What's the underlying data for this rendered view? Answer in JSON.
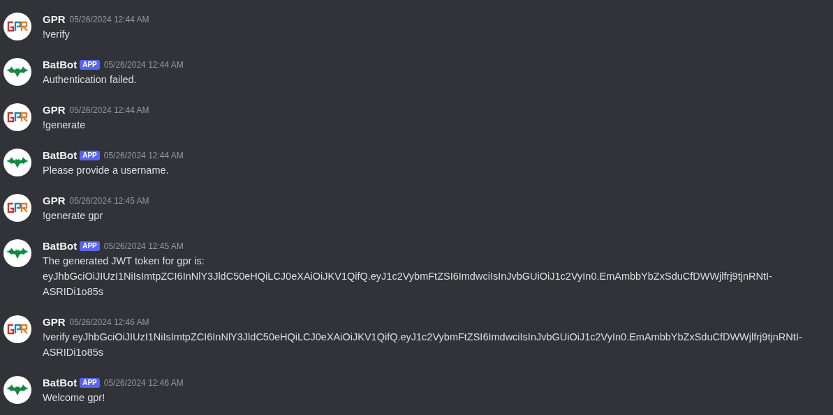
{
  "messages": [
    {
      "author": "GPR",
      "kind": "user",
      "timestamp": "05/26/2024 12:44 AM",
      "lines": [
        "!verify"
      ]
    },
    {
      "author": "BatBot",
      "kind": "bot",
      "badge": "APP",
      "timestamp": "05/26/2024 12:44 AM",
      "lines": [
        "Authentication failed."
      ]
    },
    {
      "author": "GPR",
      "kind": "user",
      "timestamp": "05/26/2024 12:44 AM",
      "lines": [
        "!generate"
      ]
    },
    {
      "author": "BatBot",
      "kind": "bot",
      "badge": "APP",
      "timestamp": "05/26/2024 12:44 AM",
      "lines": [
        "Please provide a username."
      ]
    },
    {
      "author": "GPR",
      "kind": "user",
      "timestamp": "05/26/2024 12:45 AM",
      "lines": [
        "!generate gpr"
      ]
    },
    {
      "author": "BatBot",
      "kind": "bot",
      "badge": "APP",
      "timestamp": "05/26/2024 12:45 AM",
      "lines": [
        "The generated JWT token for gpr is:",
        "eyJhbGciOiJIUzI1NiIsImtpZCI6InNlY3JldC50eHQiLCJ0eXAiOiJKV1QifQ.eyJ1c2VybmFtZSI6ImdwciIsInJvbGUiOiJ1c2VyIn0.EmAmbbYbZxSduCfDWWjlfrj9tjnRNtI-ASRIDi1o85s"
      ]
    },
    {
      "author": "GPR",
      "kind": "user",
      "timestamp": "05/26/2024 12:46 AM",
      "lines": [
        "!verify eyJhbGciOiJIUzI1NiIsImtpZCI6InNlY3JldC50eHQiLCJ0eXAiOiJKV1QifQ.eyJ1c2VybmFtZSI6ImdwciIsInJvbGUiOiJ1c2VyIn0.EmAmbbYbZxSduCfDWWjlfrj9tjnRNtI-ASRIDi1o85s"
      ]
    },
    {
      "author": "BatBot",
      "kind": "bot",
      "badge": "APP",
      "timestamp": "05/26/2024 12:46 AM",
      "lines": [
        "Welcome gpr!"
      ]
    }
  ]
}
